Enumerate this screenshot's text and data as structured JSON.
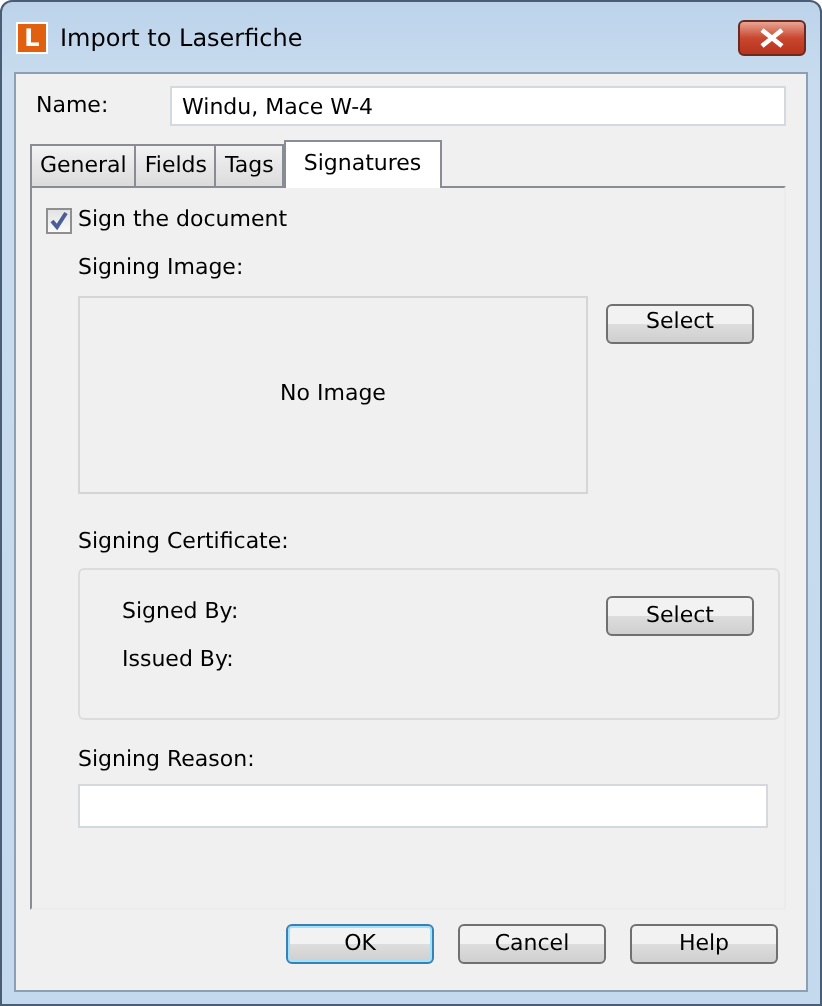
{
  "window": {
    "title": "Import to Laserfiche",
    "logo": "L"
  },
  "name_field": {
    "label": "Name:",
    "value": "Windu, Mace W-4"
  },
  "tabs": [
    {
      "label": "General",
      "selected": false
    },
    {
      "label": "Fields",
      "selected": false
    },
    {
      "label": "Tags",
      "selected": false
    },
    {
      "label": "Signatures",
      "selected": true
    }
  ],
  "sign_checkbox": {
    "label": "Sign the document",
    "checked": true
  },
  "signing_image": {
    "label": "Signing Image:",
    "empty_text": "No Image",
    "button": "Select"
  },
  "signing_certificate": {
    "label": "Signing Certificate:",
    "fields": [
      "Signed By:",
      "Issued By:"
    ],
    "button": "Select"
  },
  "signing_reason": {
    "label": "Signing Reason:"
  },
  "buttons": [
    {
      "label": "OK",
      "default": true
    },
    {
      "label": "Cancel",
      "default": false
    },
    {
      "label": "Help",
      "default": false
    }
  ]
}
